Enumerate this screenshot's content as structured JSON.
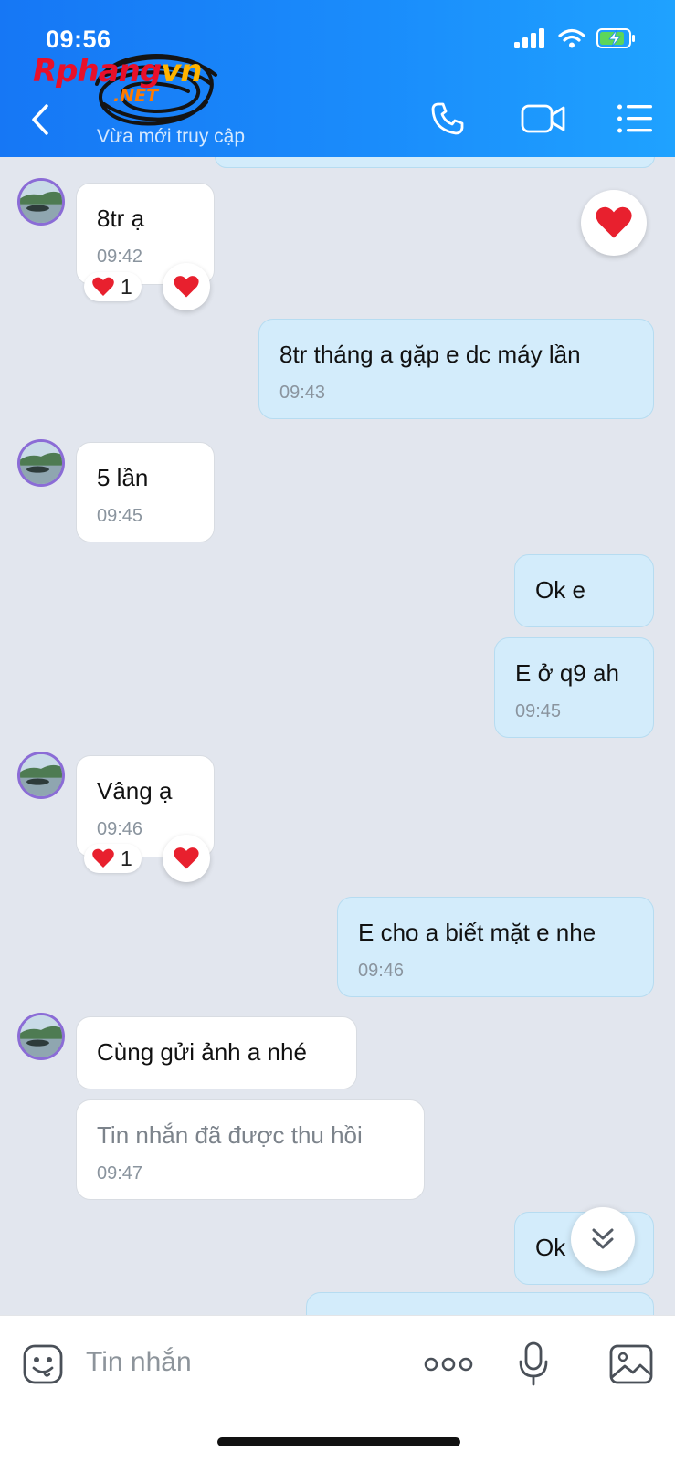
{
  "status_bar": {
    "time": "09:56"
  },
  "header": {
    "watermark": {
      "text_r": "Rphang",
      "text_g": "vn",
      "text_net": ".NET"
    },
    "subtitle": "Vừa mới truy cập",
    "icons": [
      "back-chevron-icon",
      "phone-icon",
      "video-call-icon",
      "menu-list-icon"
    ]
  },
  "messages": [
    {
      "side": "in",
      "text": "8tr ạ",
      "time": "09:42",
      "reaction_count": "1"
    },
    {
      "side": "out",
      "text": "8tr tháng a gặp e dc máy lần",
      "time": "09:43"
    },
    {
      "side": "in",
      "text": "5 lần",
      "time": "09:45"
    },
    {
      "side": "out",
      "text": "Ok e"
    },
    {
      "side": "out",
      "text": "E ở q9 ah",
      "time": "09:45"
    },
    {
      "side": "in",
      "text": "Vâng ạ",
      "time": "09:46",
      "reaction_count": "1"
    },
    {
      "side": "out",
      "text": "E cho a biết mặt e nhe",
      "time": "09:46"
    },
    {
      "side": "in",
      "text": "Cùng gửi ảnh a nhé"
    },
    {
      "side": "in",
      "text": "Tin nhắn đã được thu hồi",
      "time": "09:47",
      "recalled": true
    },
    {
      "side": "out",
      "text": "Ok"
    }
  ],
  "composer": {
    "placeholder": "Tin nhắn"
  },
  "colors": {
    "header": "#1a8cfb",
    "outgoing_bubble": "#d3ecfb",
    "incoming_bubble": "#ffffff",
    "chat_bg": "#e2e6ee",
    "heart": "#e8202e"
  }
}
